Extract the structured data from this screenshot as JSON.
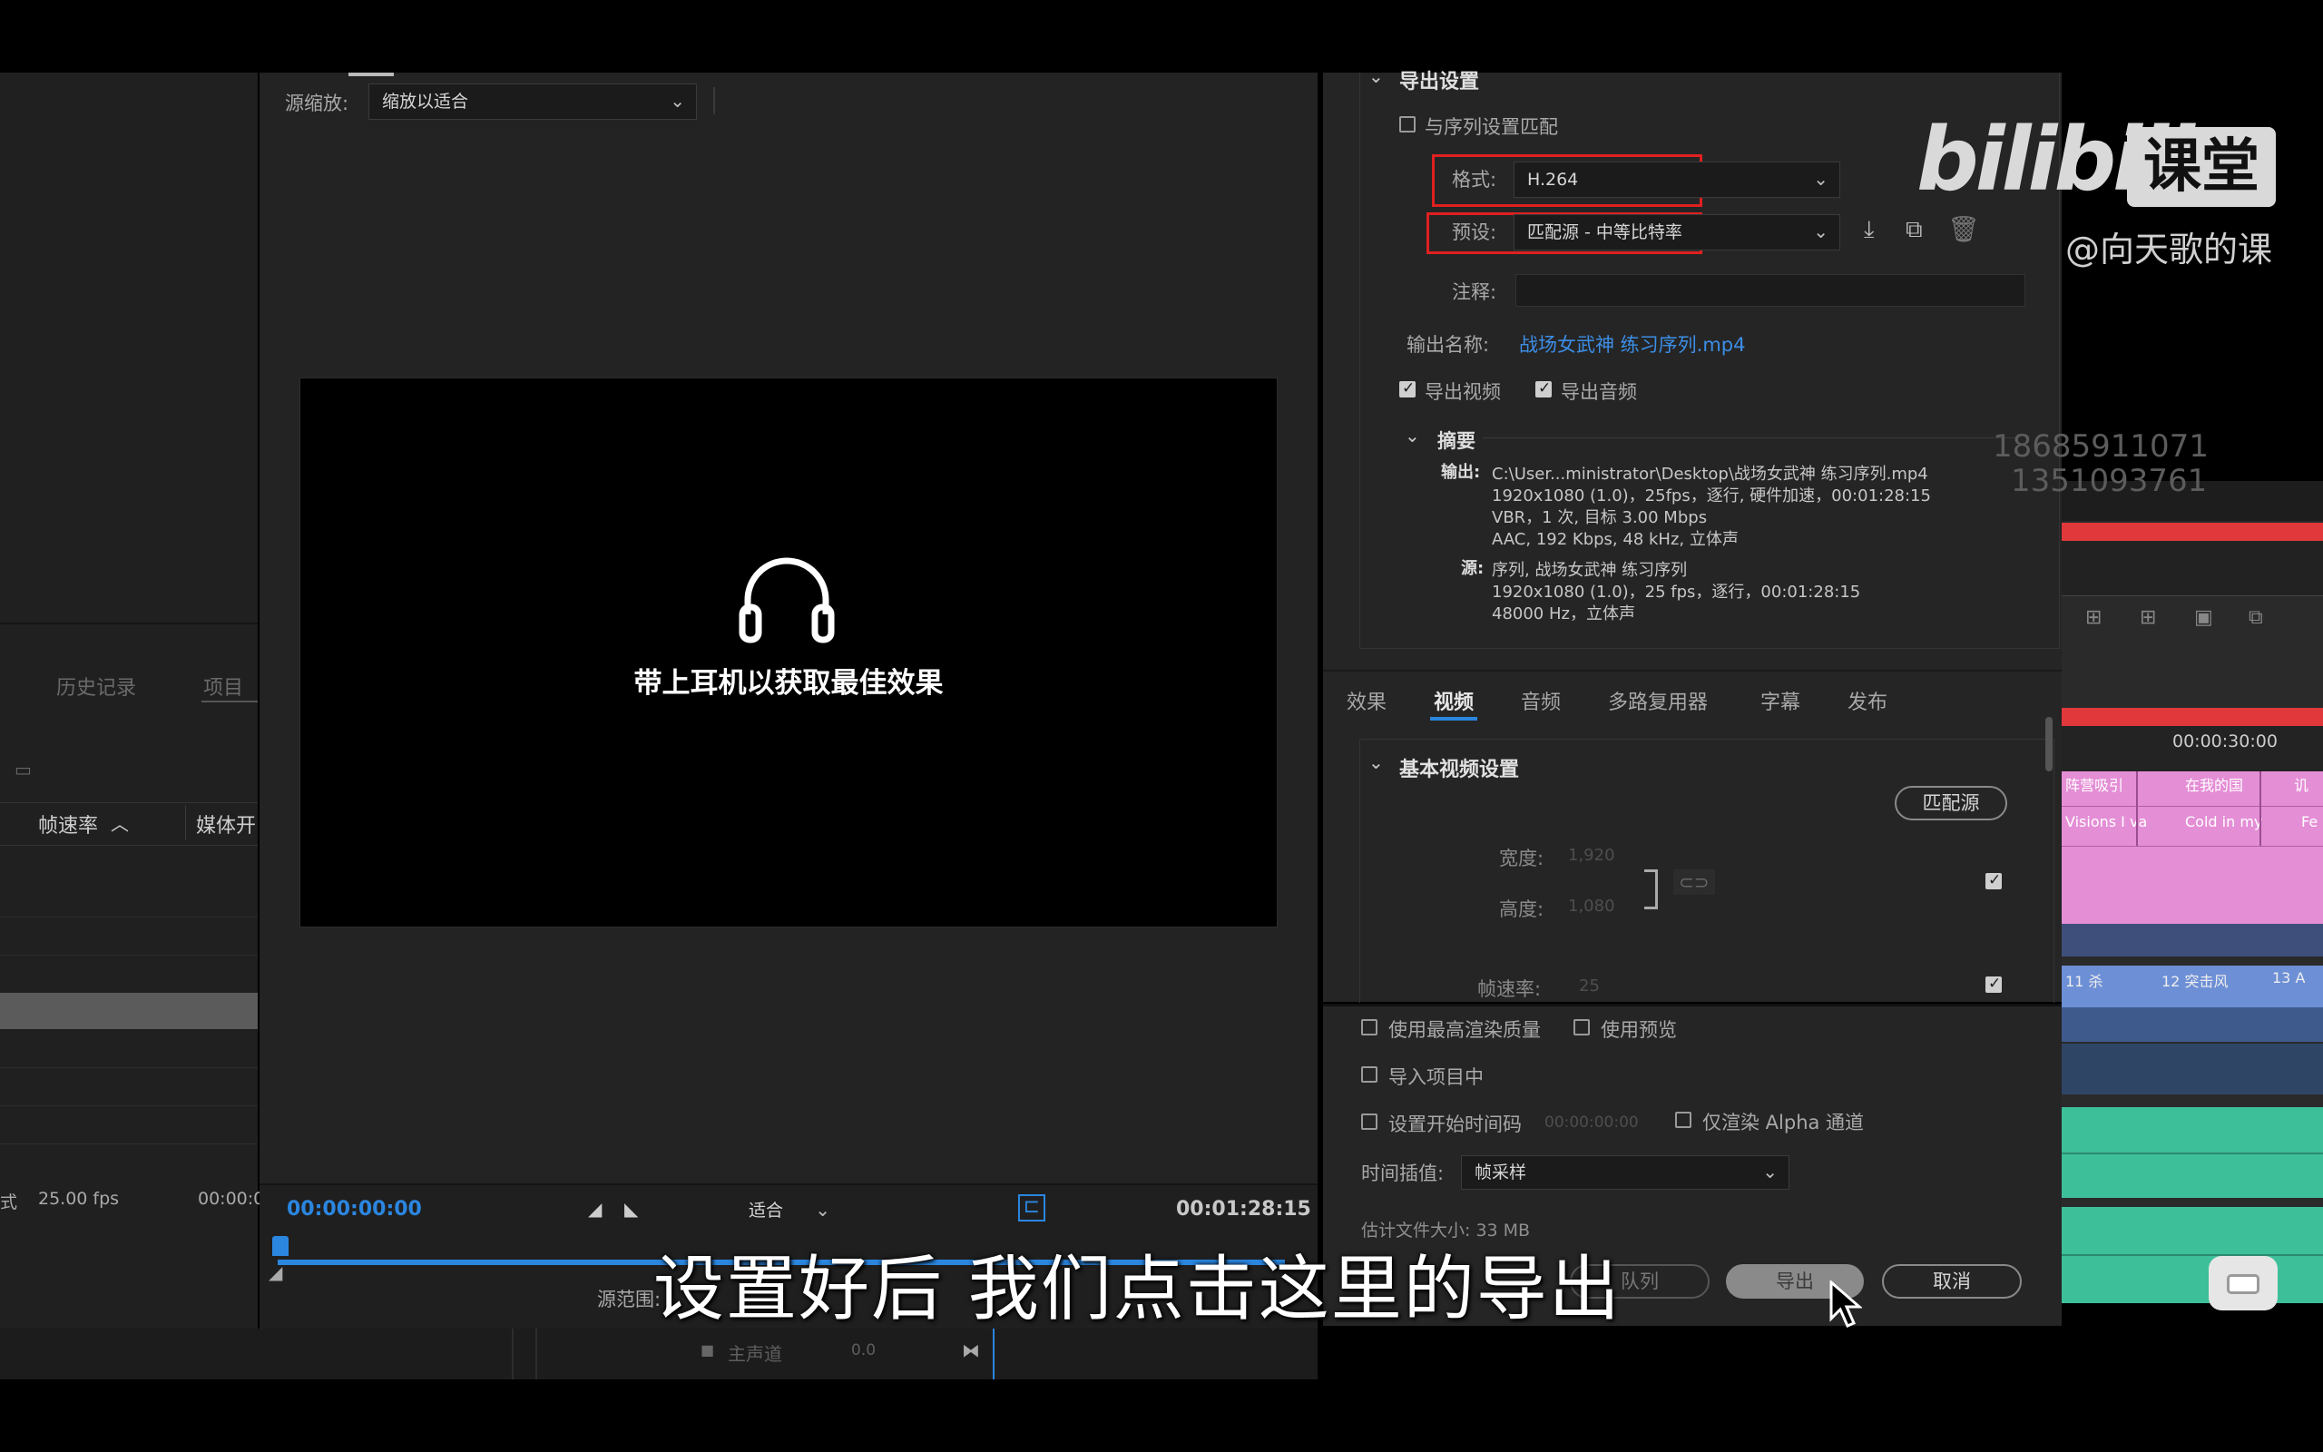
{
  "left_panel": {
    "tabs": [
      "历史记录",
      "项目"
    ],
    "columns": [
      "帧速率",
      "媒体开"
    ],
    "row_values": [
      "式",
      "25.00 fps",
      "00:00:0"
    ]
  },
  "source": {
    "scaling_label": "源缩放:",
    "scaling_value": "缩放以适合",
    "preview_text": "带上耳机以获取最佳效果",
    "current_time": "00:00:00:00",
    "fit_value": "适合",
    "duration": "00:01:28:15",
    "range_label": "源范围:"
  },
  "export": {
    "section_title": "导出设置",
    "match_sequence": "与序列设置匹配",
    "format_label": "格式:",
    "format_value": "H.264",
    "preset_label": "预设:",
    "preset_value": "匹配源 - 中等比特率",
    "comment_label": "注释:",
    "output_name_label": "输出名称:",
    "output_name_value": "战场女武神 练习序列.mp4",
    "export_video": "导出视频",
    "export_audio": "导出音频",
    "summary_title": "摘要",
    "summary_output_label": "输出:",
    "summary_output_lines": [
      "C:\\User...ministrator\\Desktop\\战场女武神 练习序列.mp4",
      "1920x1080 (1.0)，25fps，逐行, 硬件加速，00:01:28:15",
      "VBR，1 次, 目标 3.00 Mbps",
      "AAC, 192 Kbps, 48  kHz, 立体声"
    ],
    "summary_source_label": "源:",
    "summary_source_lines": [
      "序列, 战场女武神 练习序列",
      "1920x1080 (1.0)，25 fps，逐行，00:01:28:15",
      "48000 Hz，立体声"
    ]
  },
  "tabs": [
    "效果",
    "视频",
    "音频",
    "多路复用器",
    "字幕",
    "发布"
  ],
  "active_tab": "视频",
  "video": {
    "section_title": "基本视频设置",
    "match_source_button": "匹配源",
    "width_label": "宽度:",
    "width_value": "1,920",
    "height_label": "高度:",
    "height_value": "1,080",
    "fps_label": "帧速率:",
    "fps_value": "25"
  },
  "bottom": {
    "max_quality": "使用最高渲染质量",
    "use_preview": "使用预览",
    "import_project": "导入项目中",
    "start_timecode": "设置开始时间码",
    "start_timecode_value": "00:00:00:00",
    "alpha_only": "仅渲染 Alpha 通道",
    "interp_label": "时间插值:",
    "interp_value": "帧采样",
    "file_size": "估计文件大小:  33 MB",
    "queue_button": "队列",
    "export_button": "导出",
    "cancel_button": "取消"
  },
  "timeline": {
    "timecode": "00:00:30:00",
    "clips_row1": [
      "阵营吸引",
      "在我的国",
      "讥"
    ],
    "clips_row2": [
      "Visions I va",
      "Cold in my",
      "Fe"
    ],
    "clips_row3": [
      "11 杀",
      "12 突击风",
      "13 A"
    ],
    "master_label": "主声道",
    "master_value": "0.0"
  },
  "watermark": {
    "brand": "bilibili",
    "brand_suffix": "课堂",
    "author": "@向天歌的课",
    "phone1": "18685911071",
    "phone2": "1351093761"
  },
  "subtitle": "设置好后  我们点击这里的导出",
  "colors": {
    "accent_blue": "#2b86e0",
    "highlight_red": "#e02020",
    "clip_pink": "#e48ed6",
    "audio_green": "#3dbf9a"
  }
}
